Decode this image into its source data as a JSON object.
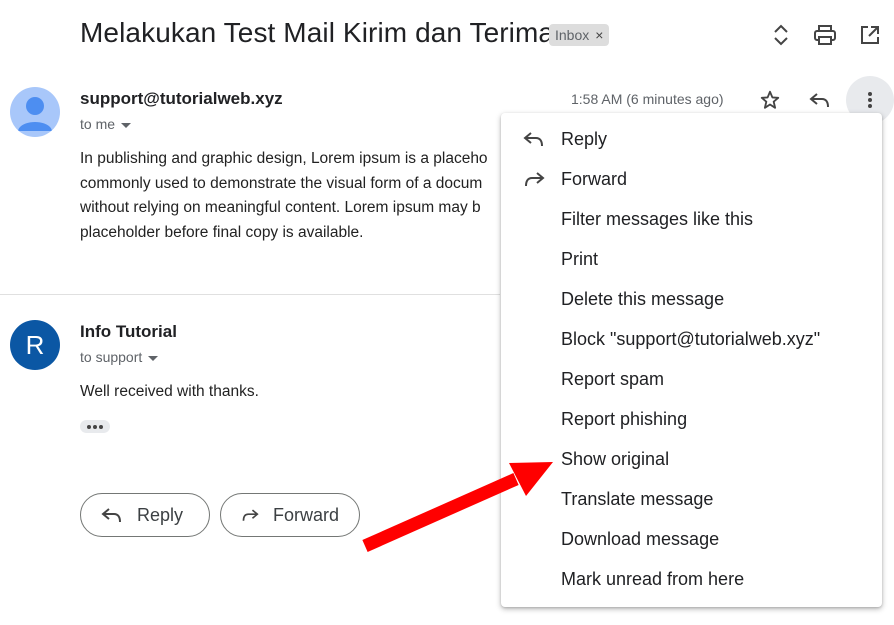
{
  "thread": {
    "subject": "Melakukan Test Mail Kirim dan Terima",
    "label": "Inbox",
    "label_remove": "×"
  },
  "message1": {
    "sender": "support@tutorialweb.xyz",
    "to": "to me",
    "time": "1:58 AM (6 minutes ago)",
    "body_lines": [
      "In publishing and graphic design, Lorem ipsum is a placeho",
      "commonly used to demonstrate the visual form of a docum",
      "without relying on meaningful content. Lorem ipsum may b",
      "placeholder before final copy is available."
    ]
  },
  "message2": {
    "sender": "Info Tutorial",
    "to": "to support",
    "avatar_letter": "R",
    "body": "Well received with thanks."
  },
  "actions": {
    "reply": "Reply",
    "forward": "Forward"
  },
  "menu": {
    "items": [
      {
        "label": "Reply",
        "icon": "reply-icon"
      },
      {
        "label": "Forward",
        "icon": "forward-icon"
      },
      {
        "label": "Filter messages like this"
      },
      {
        "label": "Print"
      },
      {
        "label": "Delete this message"
      },
      {
        "label": "Block \"support@tutorialweb.xyz\""
      },
      {
        "label": "Report spam"
      },
      {
        "label": "Report phishing"
      },
      {
        "label": "Show original"
      },
      {
        "label": "Translate message"
      },
      {
        "label": "Download message"
      },
      {
        "label": "Mark unread from here"
      }
    ]
  },
  "colors": {
    "avatar1_bg": "#a8c7fa",
    "avatar1_fg": "#4d8ef1",
    "avatar2_bg": "#0b57a4",
    "arrow": "#ff0000"
  }
}
